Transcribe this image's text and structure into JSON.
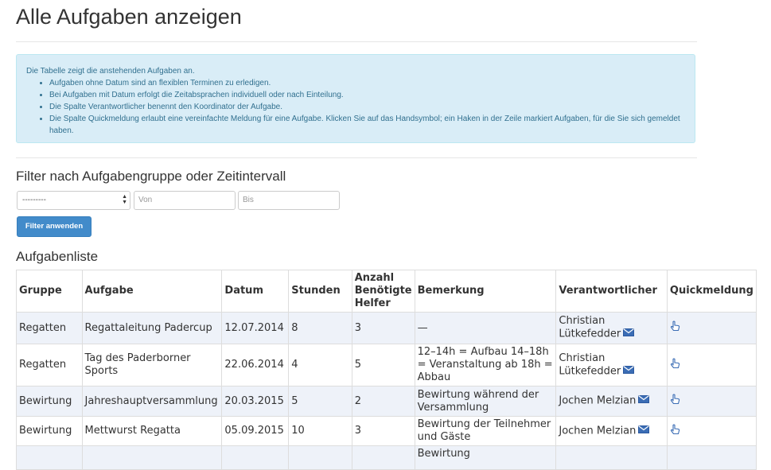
{
  "page": {
    "title": "Alle Aufgaben anzeigen"
  },
  "info": {
    "intro": "Die Tabelle zeigt die anstehenden Aufgaben an.",
    "bullets": [
      "Aufgaben ohne Datum sind an flexiblen Terminen zu erledigen.",
      "Bei Aufgaben mit Datum erfolgt die Zeitabsprachen individuell oder nach Einteilung.",
      "Die Spalte Verantwortlicher benennt den Koordinator der Aufgabe.",
      "Die Spalte Quickmeldung erlaubt eine vereinfachte Meldung für eine Aufgabe. Klicken Sie auf das Handsymbol; ein Haken in der Zeile markiert Aufgaben, für die Sie sich gemeldet haben."
    ]
  },
  "filter": {
    "heading": "Filter nach Aufgabengruppe oder Zeitintervall",
    "group_select_value": "---------",
    "from_placeholder": "Von",
    "to_placeholder": "Bis",
    "apply_label": "Filter anwenden"
  },
  "list": {
    "heading": "Aufgabenliste",
    "columns": {
      "group": "Gruppe",
      "task": "Aufgabe",
      "date": "Datum",
      "hours": "Stunden",
      "helpers": "Anzahl Benötigte Helfer",
      "remark": "Bemerkung",
      "responsible": "Verantwortlicher",
      "quick": "Quickmeldung"
    },
    "rows": [
      {
        "group": "Regatten",
        "task": "Regattaleitung Padercup",
        "date": "12.07.2014",
        "hours": "8",
        "helpers": "3",
        "remark": "—",
        "responsible": "Christian Lütkefedder"
      },
      {
        "group": "Regatten",
        "task": "Tag des Paderborner Sports",
        "date": "22.06.2014",
        "hours": "4",
        "helpers": "5",
        "remark": "12–14h = Aufbau 14–18h = Veranstaltung ab 18h = Abbau",
        "responsible": "Christian Lütkefedder"
      },
      {
        "group": "Bewirtung",
        "task": "Jahreshauptversammlung",
        "date": "20.03.2015",
        "hours": "5",
        "helpers": "2",
        "remark": "Bewirtung während der Versammlung",
        "responsible": "Jochen Melzian"
      },
      {
        "group": "Bewirtung",
        "task": "Mettwurst Regatta",
        "date": "05.09.2015",
        "hours": "10",
        "helpers": "3",
        "remark": "Bewirtung der Teilnehmer und Gäste",
        "responsible": "Jochen Melzian"
      },
      {
        "group": "",
        "task": "",
        "date": "",
        "hours": "",
        "helpers": "",
        "remark": "Bewirtung",
        "responsible": ""
      }
    ]
  },
  "icons": {
    "mail": "envelope-icon",
    "quick": "hand-pointer-icon"
  },
  "colors": {
    "info_bg": "#d9edf7",
    "info_text": "#31708f",
    "button_bg": "#428bca",
    "stripe": "#eef2f9",
    "icon_blue": "#3b6db5"
  }
}
